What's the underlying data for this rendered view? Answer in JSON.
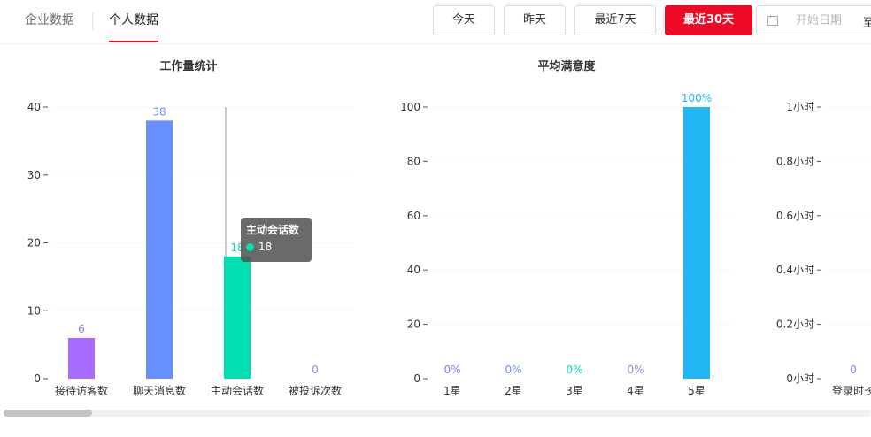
{
  "tabs": [
    {
      "label": "企业数据",
      "active": false
    },
    {
      "label": "个人数据",
      "active": true
    }
  ],
  "range_buttons": [
    {
      "label": "今天",
      "active": false
    },
    {
      "label": "昨天",
      "active": false
    },
    {
      "label": "最近7天",
      "active": false
    },
    {
      "label": "最近30天",
      "active": true
    }
  ],
  "date_range": {
    "start_placeholder": "开始日期",
    "separator": "至",
    "icon": "calendar-icon"
  },
  "colors": {
    "accent": "#ee0a24",
    "purple": "#a66cff",
    "blue": "#6690ff",
    "teal": "#00e0b0",
    "lilac": "#8a8fd6",
    "sky": "#1fb8f5"
  },
  "chart_data": [
    {
      "type": "bar",
      "title": "工作量统计",
      "categories": [
        "接待访客数",
        "聊天消息数",
        "主动会话数",
        "被投诉次数"
      ],
      "values": [
        6,
        38,
        18,
        0
      ],
      "value_labels": [
        "6",
        "38",
        "18",
        "0"
      ],
      "colors": [
        "#a66cff",
        "#6690ff",
        "#00e0b0",
        "#8a8fd6"
      ],
      "yticks": [
        "0",
        "10",
        "20",
        "30",
        "40"
      ],
      "ylim": [
        0,
        40
      ],
      "tooltip": {
        "title": "主动会话数",
        "value": "18"
      }
    },
    {
      "type": "bar",
      "title": "平均满意度",
      "categories": [
        "1星",
        "2星",
        "3星",
        "4星",
        "5星"
      ],
      "values": [
        0,
        0,
        0,
        0,
        100
      ],
      "value_labels": [
        "0%",
        "0%",
        "0%",
        "0%",
        "100%"
      ],
      "colors": [
        "#a66cff",
        "#6690ff",
        "#00e0b0",
        "#8a8fd6",
        "#1fb8f5"
      ],
      "yticks": [
        "0",
        "20",
        "40",
        "60",
        "80",
        "100"
      ],
      "ylim": [
        0,
        100
      ]
    },
    {
      "type": "bar",
      "title": "",
      "categories": [
        "登录时长"
      ],
      "values": [
        0
      ],
      "value_labels": [
        "0"
      ],
      "colors": [
        "#a66cff"
      ],
      "yticks": [
        "0小时",
        "0.2小时",
        "0.4小时",
        "0.6小时",
        "0.8小时",
        "1小时"
      ],
      "ylim": [
        0,
        1
      ]
    }
  ]
}
